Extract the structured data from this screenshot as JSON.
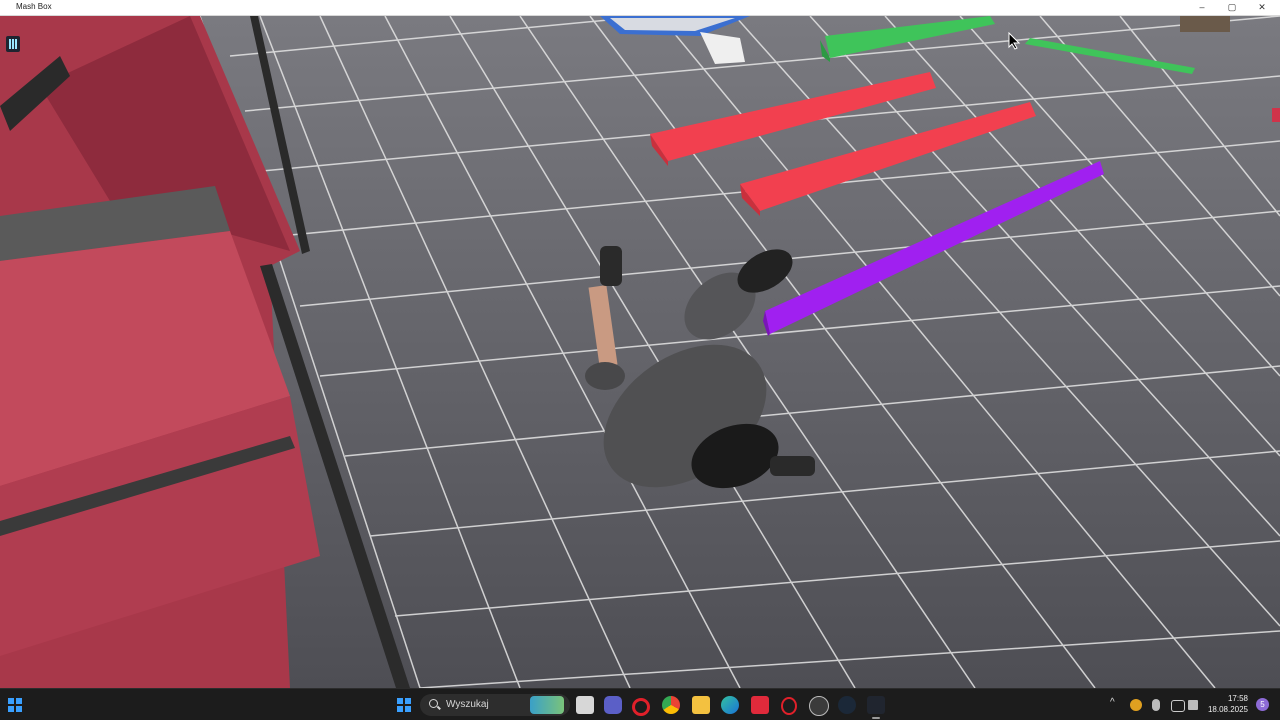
{
  "window": {
    "title": "Mash Box",
    "controls": {
      "minimize": "–",
      "maximize": "▢",
      "close": "✕"
    }
  },
  "game": {
    "hud_icon": "game-logo-icon",
    "scene": "ragdoll-falling-on-grid-floor",
    "colors": {
      "floor": "#5b5b60",
      "grid": "#e8e8e8",
      "red_beam": "#f2404f",
      "green_beam": "#3fc45a",
      "purple_beam": "#a020f0",
      "wall": "#a8384a"
    }
  },
  "taskbar": {
    "search_label": "Wyszukaj",
    "icons": [
      "windows-start-icon",
      "search-icon",
      "widgets-icon",
      "file-manager-icon",
      "teams-icon",
      "opera-icon",
      "chrome-icon",
      "folder-icon",
      "edge-icon",
      "app-w-icon",
      "opera-gx-icon",
      "epic-icon",
      "steam-icon",
      "mash-box-icon"
    ],
    "tray": {
      "chevron": "^",
      "time": "17:58",
      "date": "18.08.2025",
      "notifications": "5"
    }
  }
}
